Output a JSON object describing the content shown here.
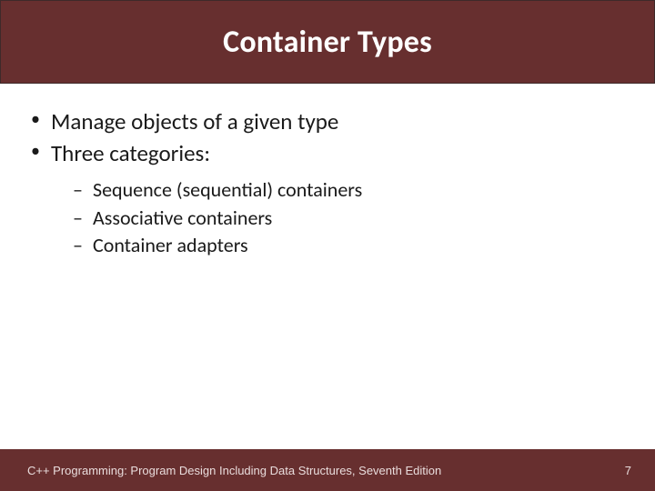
{
  "title": "Container Types",
  "bullets": [
    {
      "text": "Manage objects of a given type"
    },
    {
      "text": "Three categories:"
    }
  ],
  "sub_bullets": [
    {
      "text": "Sequence (sequential) containers"
    },
    {
      "text": "Associative containers"
    },
    {
      "text": "Container adapters"
    }
  ],
  "footer": {
    "book": "C++ Programming: Program Design Including Data Structures, Seventh Edition",
    "page": "7"
  }
}
